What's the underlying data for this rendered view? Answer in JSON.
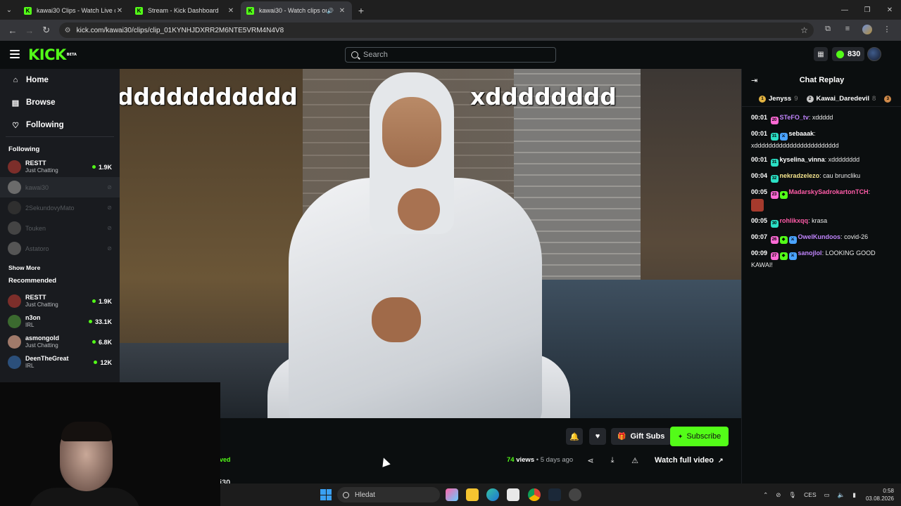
{
  "browser": {
    "tabs": [
      {
        "title": "kawai30 Clips - Watch Live on K",
        "active": false,
        "audio": false
      },
      {
        "title": "Stream - Kick Dashboard",
        "active": false,
        "audio": false
      },
      {
        "title": "kawai30 - Watch clips on Ki",
        "active": true,
        "audio": true
      }
    ],
    "url": "kick.com/kawai30/clips/clip_01KYNHJDXRR2M6NTE5VRM4N4V8"
  },
  "header": {
    "logo": "KICK",
    "logo_badge": "BETA",
    "search_placeholder": "Search",
    "points": "830"
  },
  "sidebar": {
    "nav": [
      {
        "label": "Home",
        "icon": "home-icon"
      },
      {
        "label": "Browse",
        "icon": "browse-icon"
      },
      {
        "label": "Following",
        "icon": "heart-icon"
      }
    ],
    "following_title": "Following",
    "following": [
      {
        "name": "RESTT",
        "category": "Just Chatting",
        "viewers": "1.9K",
        "live": true,
        "color": "#7c2e2a"
      },
      {
        "name": "kawai30",
        "category": "",
        "viewers": "",
        "live": false,
        "selected": true,
        "color": "#6b6b6b"
      },
      {
        "name": "2SekundovyMato",
        "category": "",
        "viewers": "",
        "live": false,
        "color": "#2f2f2f"
      },
      {
        "name": "Touken",
        "category": "",
        "viewers": "",
        "live": false,
        "color": "#444"
      },
      {
        "name": "Astatoro",
        "category": "",
        "viewers": "",
        "live": false,
        "color": "#555"
      }
    ],
    "show_more": "Show More",
    "recommended_title": "Recommended",
    "recommended": [
      {
        "name": "RESTT",
        "category": "Just Chatting",
        "viewers": "1.9K",
        "color": "#7c2e2a"
      },
      {
        "name": "n3on",
        "category": "IRL",
        "viewers": "33.1K",
        "color": "#3b6a2f"
      },
      {
        "name": "asmongold",
        "category": "Just Chatting",
        "viewers": "6.8K",
        "color": "#a07a6a"
      },
      {
        "name": "DeenTheGreat",
        "category": "IRL",
        "viewers": "12K",
        "color": "#2b4f7a"
      }
    ]
  },
  "video": {
    "overlay_left": "ddddddddddd",
    "overlay_right": "xdddddddd"
  },
  "below_video": {
    "gift_subs": "Gift Subs",
    "subscribe": "Subscribe",
    "views_count": "74",
    "views_label": "views",
    "time_ago": "5 days ago",
    "watch_full": "Watch full video",
    "saved_fragment": "ved",
    "name_fragment": "i30"
  },
  "chat": {
    "title": "Chat Replay",
    "gifters": [
      {
        "name": "Jenyss",
        "count": "9",
        "color": "#e3b341"
      },
      {
        "name": "Kawai_Daredevil",
        "count": "8",
        "color": "#c8c8c8"
      }
    ],
    "messages": [
      {
        "time": "00:01",
        "badges": [
          {
            "label": "20",
            "color": "#ff6ad5"
          }
        ],
        "user": "STeFO_tv",
        "user_color": "#c084fc",
        "text": "xddddd"
      },
      {
        "time": "00:01",
        "badges": [
          {
            "label": "31",
            "color": "#2be0c5"
          },
          {
            "label": "⚔",
            "color": "#4aa3ff"
          }
        ],
        "user": "sebaaak",
        "user_color": "#ffffff",
        "text": "xdddddddddddddddddddddddd"
      },
      {
        "time": "00:01",
        "badges": [
          {
            "label": "31",
            "color": "#2be0c5"
          }
        ],
        "user": "kyselina_vinna",
        "user_color": "#ffffff",
        "text": "xdddddddd"
      },
      {
        "time": "00:04",
        "badges": [
          {
            "label": "32",
            "color": "#2be0c5"
          }
        ],
        "user": "nekradzelezo",
        "user_color": "#f6e58d",
        "text": "cau bruncliku"
      },
      {
        "time": "00:05",
        "badges": [
          {
            "label": "23",
            "color": "#ff6ad5"
          },
          {
            "label": "◆",
            "color": "#53fc18"
          }
        ],
        "user": "MadarskySadrokartonTCH",
        "user_color": "#ff5ca8",
        "text": "",
        "emote": true
      },
      {
        "time": "00:05",
        "badges": [
          {
            "label": "30",
            "color": "#2be0c5"
          }
        ],
        "user": "rohlikxqq",
        "user_color": "#ff5ca8",
        "text": "krasa"
      },
      {
        "time": "00:07",
        "badges": [
          {
            "label": "26",
            "color": "#ff6ad5"
          },
          {
            "label": "◆",
            "color": "#53fc18"
          },
          {
            "label": "⚔",
            "color": "#4aa3ff"
          }
        ],
        "user": "OwelKundoos",
        "user_color": "#c084fc",
        "text": "covid-26"
      },
      {
        "time": "00:09",
        "badges": [
          {
            "label": "27",
            "color": "#ff6ad5"
          },
          {
            "label": "◆",
            "color": "#53fc18"
          },
          {
            "label": "⚔",
            "color": "#4aa3ff"
          }
        ],
        "user": "sanojlol",
        "user_color": "#c084fc",
        "text": "LOOKING GOOD KAWAI!"
      }
    ]
  },
  "taskbar": {
    "search_placeholder": "Hledat",
    "lang": "CES",
    "time": "0:58",
    "date": "03.08.2026"
  }
}
